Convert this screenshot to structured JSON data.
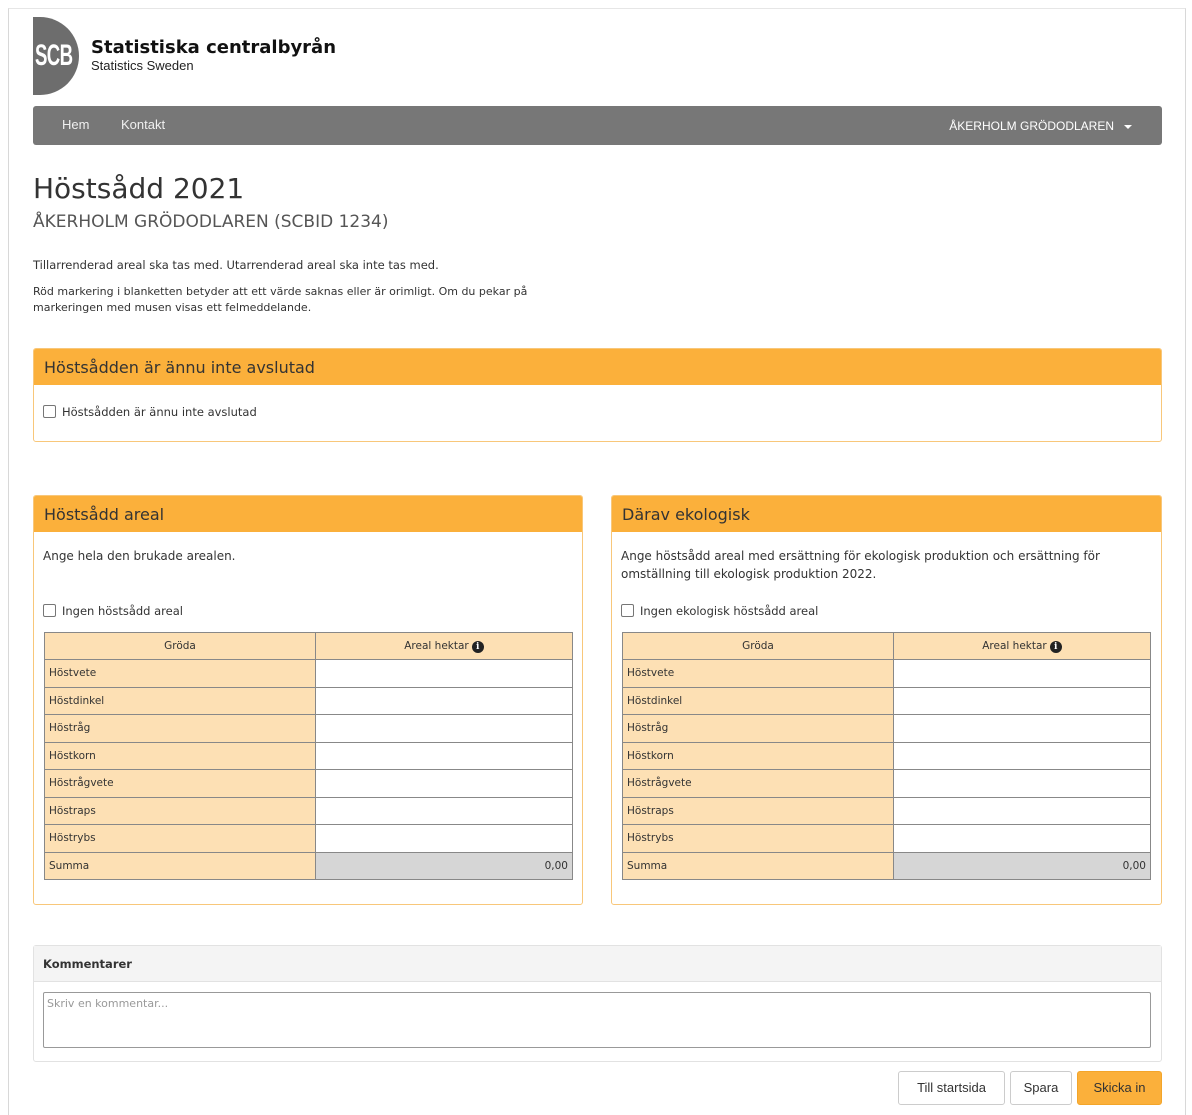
{
  "header": {
    "logo_text": "SCB",
    "org_name": "Statistiska centralbyrån",
    "org_name_en": "Statistics Sweden"
  },
  "nav": {
    "links": [
      "Hem",
      "Kontakt"
    ],
    "user_menu": "ÅKERHOLM GRÖDODLAREN"
  },
  "page": {
    "title": "Höstsådd 2021",
    "subtitle": "ÅKERHOLM GRÖDODLAREN (SCBID 1234)",
    "intro_1": "Tillarrenderad areal ska tas med. Utarrenderad areal ska inte tas med.",
    "intro_2": "Röd markering i blanketten betyder att ett värde saknas eller är orimligt. Om du pekar på markeringen med musen visas ett felmeddelande."
  },
  "not_finished_panel": {
    "heading": "Höstsådden är ännu inte avslutad",
    "checkbox_label": "Höstsådden är ännu inte avslutad",
    "checked": false
  },
  "sown_area_panel": {
    "heading": "Höstsådd areal",
    "description": "Ange hela den brukade arealen.",
    "checkbox_label": "Ingen höstsådd areal",
    "checked": false,
    "columns": [
      "Gröda",
      "Areal hektar"
    ],
    "rows": [
      "Höstvete",
      "Höstdinkel",
      "Höstråg",
      "Höstkorn",
      "Höstrågvete",
      "Höstraps",
      "Höstrybs"
    ],
    "sum_label": "Summa",
    "sum_value": "0,00"
  },
  "organic_panel": {
    "heading": "Därav ekologisk",
    "description": "Ange höstsådd areal med ersättning för ekologisk produktion och ersättning för omställning till ekologisk produktion 2022.",
    "checkbox_label": "Ingen ekologisk höstsådd areal",
    "checked": false,
    "columns": [
      "Gröda",
      "Areal hektar"
    ],
    "rows": [
      "Höstvete",
      "Höstdinkel",
      "Höstråg",
      "Höstkorn",
      "Höstrågvete",
      "Höstraps",
      "Höstrybs"
    ],
    "sum_label": "Summa",
    "sum_value": "0,00"
  },
  "comments": {
    "heading": "Kommentarer",
    "placeholder": "Skriv en kommentar..."
  },
  "actions": {
    "home_label": "Till startsida",
    "save_label": "Spara",
    "submit_label": "Skicka in"
  },
  "colors": {
    "accent": "#fbb03b",
    "table_label_bg": "#fde0b4",
    "navbar": "#777777"
  }
}
